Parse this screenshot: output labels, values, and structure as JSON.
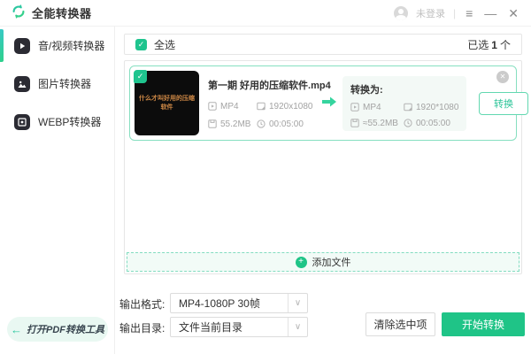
{
  "app": {
    "title": "全能转换器",
    "user_status": "未登录"
  },
  "icons": {
    "menu": "≡",
    "minimize": "—",
    "close": "✕",
    "check": "✓",
    "plus": "+",
    "close_small": "✕",
    "back_arrow": "←",
    "chevron_down": "∨",
    "divider": "|"
  },
  "sidebar": {
    "items": [
      {
        "label": "音/视频转换器",
        "icon": "video-converter-icon",
        "active": true
      },
      {
        "label": "图片转换器",
        "icon": "image-converter-icon",
        "active": false
      },
      {
        "label": "WEBP转换器",
        "icon": "webp-converter-icon",
        "active": false
      }
    ],
    "pdf_tool_label": "打开PDF转换工具"
  },
  "main": {
    "select_all_label": "全选",
    "selected_count_prefix": "已选",
    "selected_count": "1",
    "selected_count_suffix": "个",
    "file": {
      "thumbnail_text": "什么才叫好用的压缩软件",
      "name": "第一期 好用的压缩软件.mp4",
      "source": {
        "format": "MP4",
        "resolution": "1920x1080",
        "size": "55.2MB",
        "duration": "00:05:00"
      },
      "target_label": "转换为:",
      "target": {
        "format": "MP4",
        "resolution": "1920*1080",
        "size": "≈55.2MB",
        "duration": "00:05:00"
      },
      "convert_button": "转换"
    },
    "add_files_label": "添加文件"
  },
  "footer": {
    "output_format_label": "输出格式:",
    "output_format_value": "MP4-1080P 30帧",
    "output_dir_label": "输出目录:",
    "output_dir_value": "文件当前目录",
    "clear_button": "清除选中项",
    "start_button": "开始转换"
  },
  "colors": {
    "primary_green": "#1fc487",
    "teal": "#2bc7a0",
    "card_border": "#86dfc0",
    "light_mint_bg": "#f3f9f6",
    "gray_text": "#a3a3a3",
    "dark_text": "#333333"
  }
}
